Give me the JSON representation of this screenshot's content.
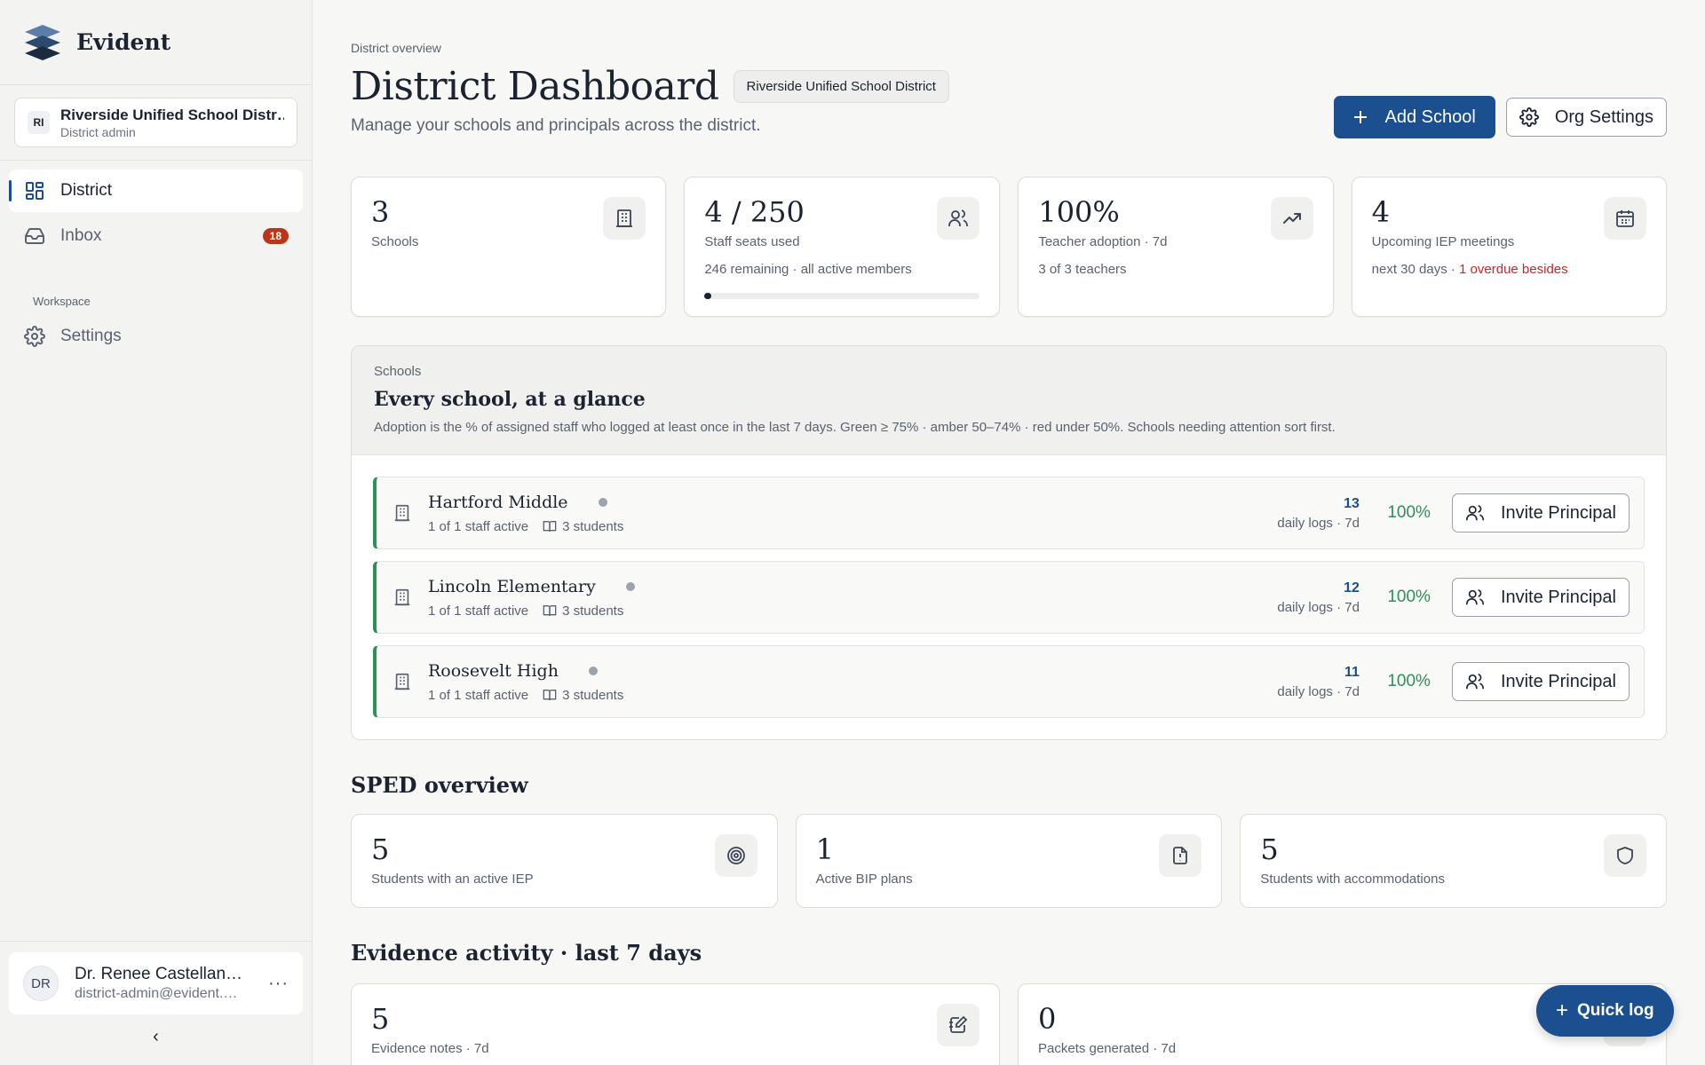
{
  "app": {
    "name": "Evident"
  },
  "org": {
    "initials": "RI",
    "name": "Riverside Unified School District",
    "role": "District admin"
  },
  "nav": {
    "items": [
      {
        "label": "District",
        "icon": "grid-icon",
        "active": true
      },
      {
        "label": "Inbox",
        "icon": "inbox-icon",
        "badge": "18"
      }
    ],
    "section_label": "Workspace",
    "workspace_items": [
      {
        "label": "Settings",
        "icon": "gear-icon"
      }
    ]
  },
  "user": {
    "initials": "DR",
    "name": "Dr. Renee Castellanos",
    "email": "district-admin@evident.app"
  },
  "header": {
    "breadcrumb": "District overview",
    "title": "District Dashboard",
    "district_pill": "Riverside Unified School District",
    "subtitle": "Manage your schools and principals across the district.",
    "add_school_label": "Add School",
    "org_settings_label": "Org Settings"
  },
  "stats": [
    {
      "value": "3",
      "label": "Schools",
      "sub": "",
      "icon": "building-icon"
    },
    {
      "value": "4 / 250",
      "label": "Staff seats used",
      "sub": "246 remaining · all active members",
      "icon": "users-icon",
      "progress": 0.016
    },
    {
      "value": "100%",
      "label": "Teacher adoption · 7d",
      "sub": "3 of 3 teachers",
      "icon": "trending-up-icon"
    },
    {
      "value": "4",
      "label": "Upcoming IEP meetings",
      "sub": "next 30 days · ",
      "sub_alert": "1 overdue besides",
      "icon": "calendar-icon"
    }
  ],
  "schools": {
    "kicker": "Schools",
    "title": "Every school, at a glance",
    "description": "Adoption is the % of assigned staff who logged at least once in the last 7 days. Green ≥ 75% · amber 50–74% · red under 50%. Schools needing attention sort first.",
    "rows": [
      {
        "name": "Hartford Middle",
        "staff": "1 of 1 staff active",
        "students": "3 students",
        "logs": "13",
        "logs_label": "daily logs · 7d",
        "adoption": "100%",
        "invite_label": "Invite Principal"
      },
      {
        "name": "Lincoln Elementary",
        "staff": "1 of 1 staff active",
        "students": "3 students",
        "logs": "12",
        "logs_label": "daily logs · 7d",
        "adoption": "100%",
        "invite_label": "Invite Principal"
      },
      {
        "name": "Roosevelt High",
        "staff": "1 of 1 staff active",
        "students": "3 students",
        "logs": "11",
        "logs_label": "daily logs · 7d",
        "adoption": "100%",
        "invite_label": "Invite Principal"
      }
    ]
  },
  "sped": {
    "title": "SPED overview",
    "cards": [
      {
        "value": "5",
        "label": "Students with an active IEP",
        "icon": "target-icon"
      },
      {
        "value": "1",
        "label": "Active BIP plans",
        "icon": "alert-file-icon"
      },
      {
        "value": "5",
        "label": "Students with accommodations",
        "icon": "shield-icon"
      }
    ]
  },
  "evidence": {
    "title": "Evidence activity · last 7 days",
    "cards": [
      {
        "value": "5",
        "label": "Evidence notes · 7d",
        "icon": "edit-note-icon"
      },
      {
        "value": "0",
        "label": "Packets generated · 7d",
        "icon": "package-icon"
      }
    ]
  },
  "fab": {
    "label": "Quick log"
  },
  "colors": {
    "accent": "#1b4f8f",
    "success": "#2f8f57",
    "danger": "#b9361b"
  }
}
